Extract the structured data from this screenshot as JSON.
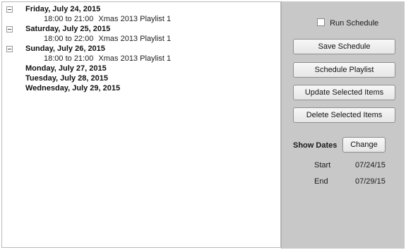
{
  "schedule": {
    "days": [
      {
        "date": "Friday, July 24, 2015",
        "expanded": true,
        "entries": [
          {
            "time": "18:00 to 21:00",
            "playlist": "Xmas 2013 Playlist 1"
          }
        ]
      },
      {
        "date": "Saturday, July 25, 2015",
        "expanded": true,
        "entries": [
          {
            "time": "18:00 to 22:00",
            "playlist": "Xmas 2013 Playlist 1"
          }
        ]
      },
      {
        "date": "Sunday, July 26, 2015",
        "expanded": true,
        "entries": [
          {
            "time": "18:00 to 21:00",
            "playlist": "Xmas 2013 Playlist 1"
          }
        ]
      },
      {
        "date": "Monday, July 27, 2015",
        "expanded": false,
        "entries": []
      },
      {
        "date": "Tuesday, July 28, 2015",
        "expanded": false,
        "entries": []
      },
      {
        "date": "Wednesday, July 29, 2015",
        "expanded": false,
        "entries": []
      }
    ]
  },
  "controls": {
    "run_schedule_label": "Run Schedule",
    "run_schedule_checked": false,
    "save_schedule_label": "Save Schedule",
    "schedule_playlist_label": "Schedule Playlist",
    "update_selected_label": "Update Selected Items",
    "delete_selected_label": "Delete Selected Items",
    "show_dates_label": "Show Dates",
    "change_label": "Change",
    "start_label": "Start",
    "start_value": "07/24/15",
    "end_label": "End",
    "end_value": "07/29/15"
  },
  "colors": {
    "panel_bg": "#c8c8c8",
    "tree_bg": "#ffffff"
  }
}
